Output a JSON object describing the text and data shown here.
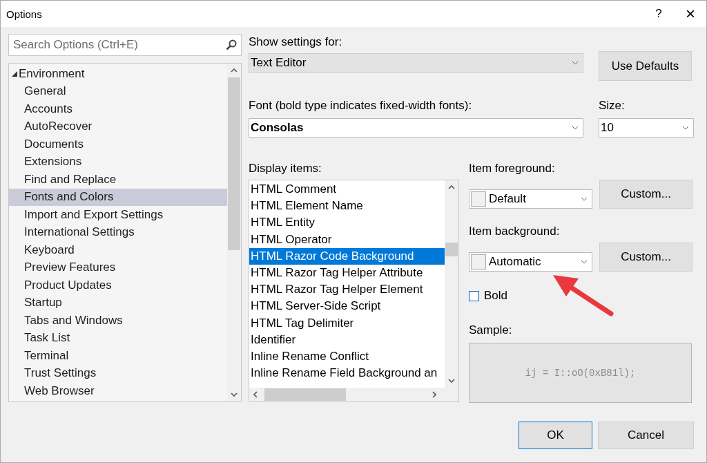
{
  "window": {
    "title": "Options",
    "help": "?",
    "close": "×"
  },
  "search": {
    "placeholder": "Search Options (Ctrl+E)"
  },
  "tree": {
    "items": [
      {
        "label": "Environment",
        "expanded": true,
        "selected": false,
        "children": [
          {
            "label": "General",
            "selected": false
          },
          {
            "label": "Accounts",
            "selected": false
          },
          {
            "label": "AutoRecover",
            "selected": false
          },
          {
            "label": "Documents",
            "selected": false
          },
          {
            "label": "Extensions",
            "selected": false
          },
          {
            "label": "Find and Replace",
            "selected": false
          },
          {
            "label": "Fonts and Colors",
            "selected": true
          },
          {
            "label": "Import and Export Settings",
            "selected": false
          },
          {
            "label": "International Settings",
            "selected": false
          },
          {
            "label": "Keyboard",
            "selected": false
          },
          {
            "label": "Preview Features",
            "selected": false
          },
          {
            "label": "Product Updates",
            "selected": false
          },
          {
            "label": "Startup",
            "selected": false
          },
          {
            "label": "Tabs and Windows",
            "selected": false
          },
          {
            "label": "Task List",
            "selected": false
          },
          {
            "label": "Terminal",
            "selected": false
          },
          {
            "label": "Trust Settings",
            "selected": false
          },
          {
            "label": "Web Browser",
            "selected": false
          }
        ]
      }
    ]
  },
  "show_settings_for": {
    "label": "Show settings for:",
    "value": "Text Editor",
    "disabled": true
  },
  "use_defaults": "Use Defaults",
  "font": {
    "label": "Font (bold type indicates fixed-width fonts):",
    "value": "Consolas"
  },
  "size": {
    "label": "Size:",
    "value": "10"
  },
  "display_items": {
    "label": "Display items:",
    "items": [
      {
        "label": "HTML Comment",
        "selected": false
      },
      {
        "label": "HTML Element Name",
        "selected": false
      },
      {
        "label": "HTML Entity",
        "selected": false
      },
      {
        "label": "HTML Operator",
        "selected": false
      },
      {
        "label": "HTML Razor Code Background",
        "selected": true
      },
      {
        "label": "HTML Razor Tag Helper Attribute",
        "selected": false
      },
      {
        "label": "HTML Razor Tag Helper Element",
        "selected": false
      },
      {
        "label": "HTML Server-Side Script",
        "selected": false
      },
      {
        "label": "HTML Tag Delimiter",
        "selected": false
      },
      {
        "label": "Identifier",
        "selected": false
      },
      {
        "label": "Inline Rename Conflict",
        "selected": false
      },
      {
        "label": "Inline Rename Field Background an",
        "selected": false
      }
    ]
  },
  "item_foreground": {
    "label": "Item foreground:",
    "value": "Default",
    "color": "#f0f0f0",
    "custom": "Custom..."
  },
  "item_background": {
    "label": "Item background:",
    "value": "Automatic",
    "color": "#f0f0f0",
    "custom": "Custom..."
  },
  "bold": {
    "label": "Bold",
    "checked": false
  },
  "sample": {
    "label": "Sample:",
    "text": "ij = I::oO(0xB81l);"
  },
  "buttons": [
    "OK",
    "Cancel"
  ]
}
